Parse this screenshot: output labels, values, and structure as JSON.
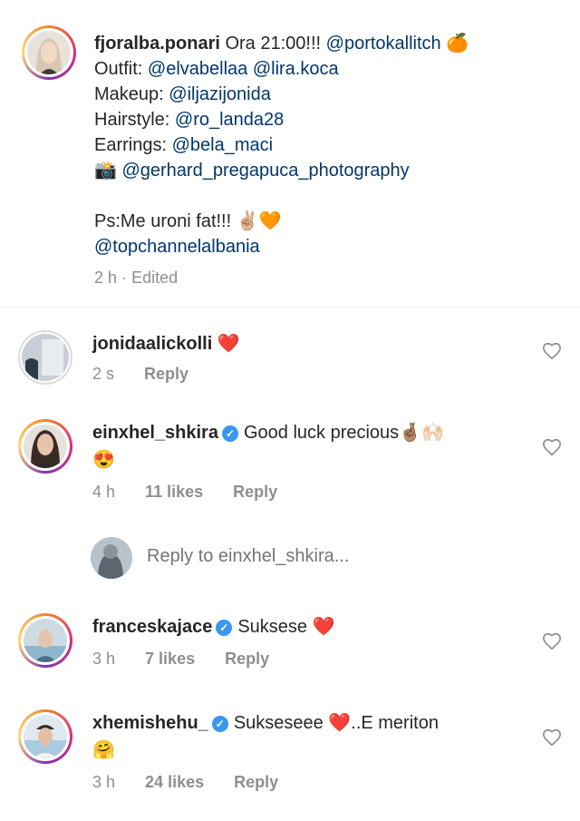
{
  "caption": {
    "username": "fjoralba.ponari",
    "line1_text": "Ora 21:00!!! ",
    "line1_mention": "@portokallitch",
    "line1_emoji": "🍊",
    "outfit_label": "Outfit: ",
    "outfit_mentions": "@elvabellaa @lira.koca",
    "makeup_label": "Makeup: ",
    "makeup_mention": "@iljazijonida",
    "hairstyle_label": "Hairstyle: ",
    "hairstyle_mention": "@ro_landa28",
    "earrings_label": "Earrings: ",
    "earrings_mention": "@bela_maci",
    "photo_emoji": "📸",
    "photo_mention": "@gerhard_pregapuca_photography",
    "ps_text": "Ps:Me uroni fat!!! ",
    "ps_emoji": "✌🏼🧡",
    "channel_mention": "@topchannelalbania",
    "time": "2 h",
    "separator": "·",
    "edited": "Edited"
  },
  "comments": [
    {
      "username": "jonidaalickolli",
      "text": "",
      "emoji": "❤️",
      "time": "2 s",
      "likes": "",
      "reply_label": "Reply"
    },
    {
      "username": "einxhel_shkira",
      "text": "Good luck precious",
      "emoji": "🤞🏽🙌🏻",
      "emoji_line2": "😍",
      "time": "4 h",
      "likes": "11 likes",
      "reply_label": "Reply"
    },
    {
      "username": "franceskajace",
      "text": "Suksese",
      "emoji": "❤️",
      "time": "3 h",
      "likes": "7 likes",
      "reply_label": "Reply"
    },
    {
      "username": "xhemishehu_",
      "text": "Sukseseee",
      "emoji": "❤️",
      "text_after": "..E meriton",
      "emoji_line2": "🤗",
      "time": "3 h",
      "likes": "24 likes",
      "reply_label": "Reply"
    }
  ],
  "reply_box": {
    "placeholder": "Reply to einxhel_shkira..."
  },
  "colors": {
    "mention": "#00376b",
    "meta": "#8e8e8e",
    "verified": "#3897f0",
    "heart": "#ed4956"
  }
}
